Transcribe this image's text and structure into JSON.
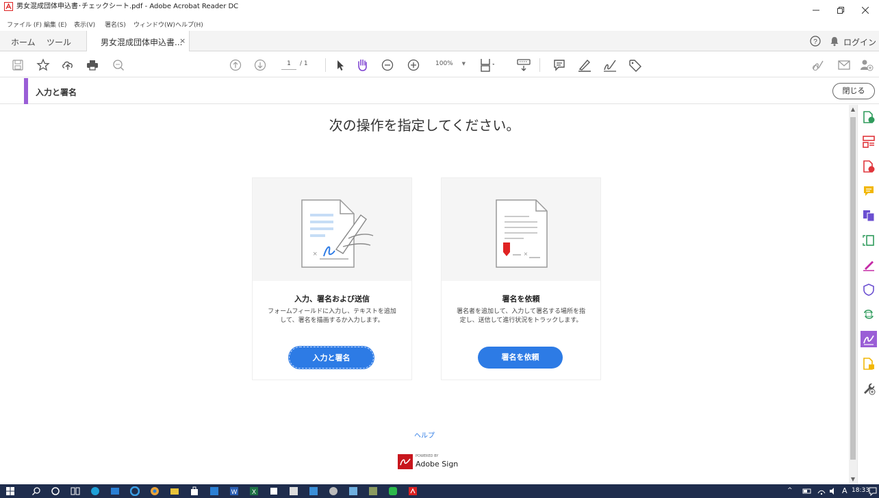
{
  "window": {
    "title": "男女混成団体申込書･チェックシート.pdf - Adobe Acrobat Reader DC"
  },
  "menu": [
    "ファイル (F)",
    "編集 (E)",
    "表示(V)",
    "署名(S)",
    "ウィンドウ(W)",
    "ヘルプ(H)"
  ],
  "tabs": {
    "home": "ホーム",
    "tools": "ツール",
    "document": "男女混成団体申込書...",
    "close": "×",
    "login": "ログイン"
  },
  "toolbar": {
    "page_current": "1",
    "page_total": "/ 1",
    "zoom": "100%"
  },
  "tool_header": {
    "name": "入力と署名",
    "close": "閉じる"
  },
  "main": {
    "heading": "次の操作を指定してください。",
    "cards": [
      {
        "title": "入力、署名および送信",
        "description": "フォームフィールドに入力し、テキストを追加して、署名を描画するか入力します。",
        "button": "入力と署名"
      },
      {
        "title": "署名を依頼",
        "description": "署名者を追加して、入力して署名する場所を指定し、送信して進行状況をトラックします。",
        "button": "署名を依頼"
      }
    ],
    "help": "ヘルプ",
    "powered_by": "POWERED BY",
    "brand": "Adobe Sign"
  },
  "taskbar": {
    "clock": "18:33",
    "ime": "A"
  },
  "colors": {
    "accent_purple": "#9a5ed6",
    "button_blue": "#2d7be5",
    "taskbar": "#1f2d4d"
  }
}
